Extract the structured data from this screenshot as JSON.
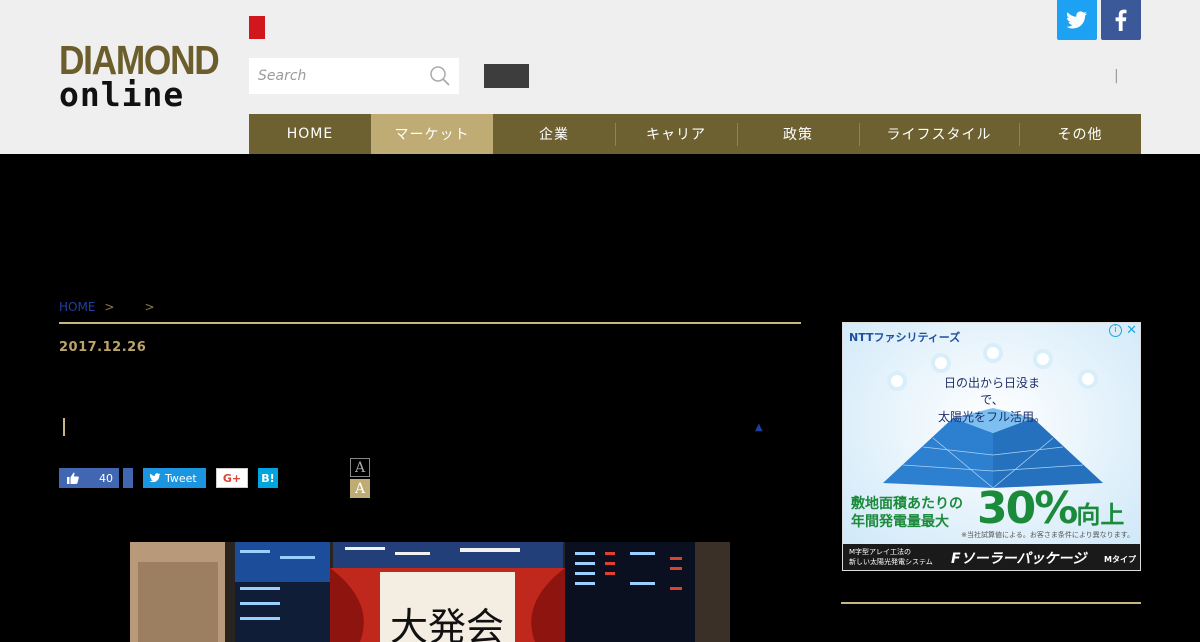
{
  "header": {
    "logo_top": "DIAMOND",
    "logo_bottom": "online",
    "search_placeholder": "Search",
    "pipe": "|"
  },
  "nav": {
    "items": [
      {
        "label": "HOME"
      },
      {
        "label": "マーケット"
      },
      {
        "label": "企業"
      },
      {
        "label": "キャリア"
      },
      {
        "label": "政策"
      },
      {
        "label": "ライフスタイル"
      },
      {
        "label": "その他"
      }
    ],
    "active_index": 1
  },
  "breadcrumb": {
    "home": "HOME",
    "sep1": ">",
    "sep2": ">"
  },
  "article": {
    "date": "2017.12.26",
    "triangle": "▲"
  },
  "share": {
    "like_count": "40",
    "tweet_label": "Tweet",
    "gplus_label": "G+",
    "hatena_label": "B!"
  },
  "font_size": {
    "small": "A",
    "large": "A"
  },
  "ad": {
    "brand": "NTTファシリティーズ",
    "info": "i",
    "close": "✕",
    "tagline_1": "日の出から日没まで、",
    "tagline_2": "太陽光をフル活用。",
    "line_1": "敷地面積あたりの",
    "line_2": "年間発電量最大",
    "big_value": "30%",
    "big_suffix": "向上",
    "note": "※当社試算値による。お客さま条件により異なります。",
    "footer_small_1": "M字型アレイ工法の",
    "footer_small_2": "新しい太陽光発電システム",
    "footer_big": "Fソーラーパッケージ",
    "footer_type": "Mタイプ"
  },
  "colors": {
    "nav_bg": "#6e6131",
    "nav_active": "#bfac75",
    "accent_red": "#d2161e",
    "twitter": "#1da1f2",
    "facebook": "#3b5998"
  }
}
